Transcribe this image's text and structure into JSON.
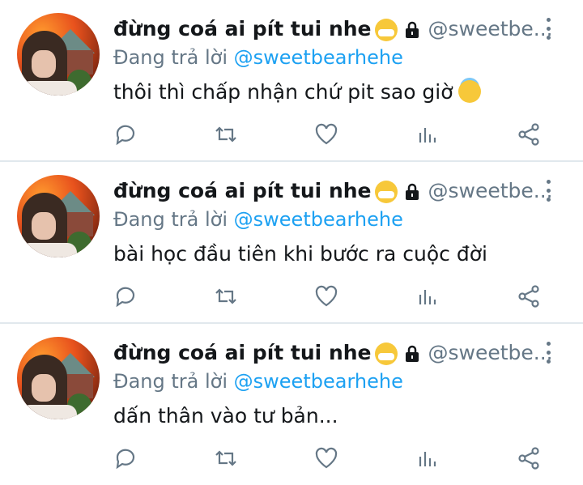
{
  "tweets": [
    {
      "name": "đừng coá ai pít tui nhe",
      "handle": "@sweetbe...",
      "reply_prefix": "Đang trả lời",
      "reply_to": "@sweetbearhehe",
      "text": "thôi thì chấp nhận chứ pit sao giờ"
    },
    {
      "name": "đừng coá ai pít tui nhe",
      "handle": "@sweetbe...",
      "reply_prefix": "Đang trả lời",
      "reply_to": "@sweetbearhehe",
      "text": "bài học đầu tiên khi bước ra cuộc đời"
    },
    {
      "name": "đừng coá ai pít tui nhe",
      "handle": "@sweetbe...",
      "reply_prefix": "Đang trả lời",
      "reply_to": "@sweetbearhehe",
      "text": "dấn thân vào tư bản..."
    }
  ],
  "icons": {
    "name_emoji": "sneezing-face-emoji",
    "lock": "lock-icon",
    "text_emoji_first": "smiling-face-with-halo-emoji",
    "more": "more-vertical-icon",
    "reply": "reply-icon",
    "retweet": "retweet-icon",
    "like": "heart-icon",
    "stats": "analytics-icon",
    "share": "share-icon"
  },
  "colors": {
    "mention": "#1da1f2",
    "muted": "#657786"
  }
}
